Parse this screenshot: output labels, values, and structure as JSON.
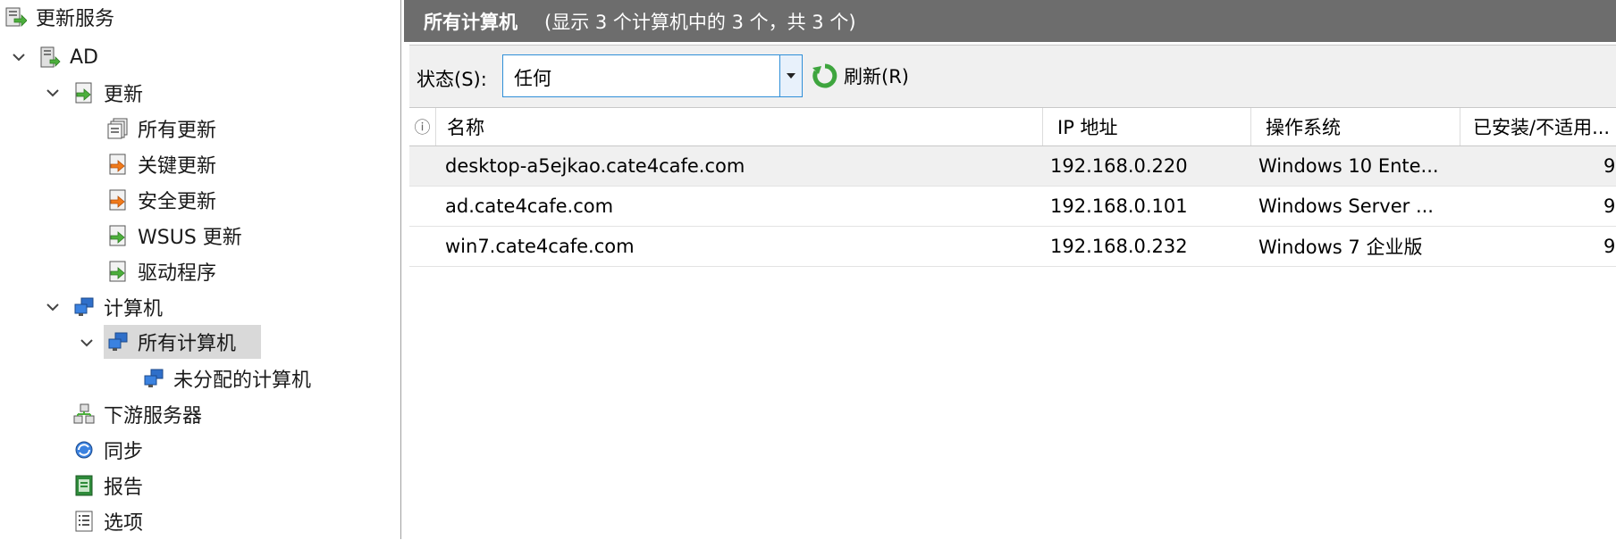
{
  "tree": {
    "root": "更新服务",
    "server": "AD",
    "updates": "更新",
    "update_children": [
      "所有更新",
      "关键更新",
      "安全更新",
      "WSUS 更新",
      "驱动程序"
    ],
    "computers": "计算机",
    "all_computers": "所有计算机",
    "unassigned": "未分配的计算机",
    "downstream": "下游服务器",
    "sync": "同步",
    "reports": "报告",
    "options": "选项"
  },
  "titlebar": {
    "title": "所有计算机",
    "summary": "(显示 3 个计算机中的 3 个，共 3 个)"
  },
  "toolbar": {
    "status_label": "状态(S):",
    "status_value": "任何",
    "refresh_label": "刷新(R)"
  },
  "list": {
    "info_symbol": "ⓘ",
    "columns": [
      "名称",
      "IP 地址",
      "操作系统",
      "已安装/不适用..."
    ],
    "rows": [
      {
        "name": "desktop-a5ejkao.cate4cafe.com",
        "ip": "192.168.0.220",
        "os": "Windows 10 Ente...",
        "pct": "9"
      },
      {
        "name": "ad.cate4cafe.com",
        "ip": "192.168.0.101",
        "os": "Windows Server ...",
        "pct": "9"
      },
      {
        "name": "win7.cate4cafe.com",
        "ip": "192.168.0.232",
        "os": "Windows 7 企业版",
        "pct": "9"
      }
    ]
  },
  "colors": {
    "titlebar_bg": "#6d6d6d",
    "selection_bg": "#d9d9d9",
    "combo_border": "#2f8fd8",
    "refresh_green": "#3ea53e"
  }
}
